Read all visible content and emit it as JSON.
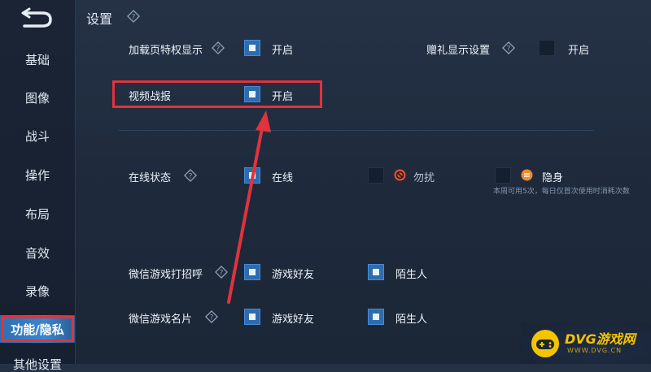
{
  "header": {
    "title": "设置"
  },
  "sidebar": {
    "items": [
      {
        "label": "基础"
      },
      {
        "label": "图像"
      },
      {
        "label": "战斗"
      },
      {
        "label": "操作"
      },
      {
        "label": "布局"
      },
      {
        "label": "音效"
      },
      {
        "label": "录像"
      },
      {
        "label": "功能/隐私",
        "active": true
      },
      {
        "label": "其他设置"
      }
    ]
  },
  "settings": {
    "loading_privilege": {
      "label": "加载页特权显示",
      "option": "开启",
      "checked": true
    },
    "gift_display": {
      "label": "赠礼显示设置",
      "option": "开启",
      "checked": false
    },
    "video_report": {
      "label": "视频战报",
      "option": "开启",
      "checked": true
    },
    "online_status": {
      "label": "在线状态",
      "options": [
        {
          "label": "在线",
          "checked": true
        },
        {
          "label": "勿扰",
          "checked": false
        },
        {
          "label": "隐身",
          "checked": false
        }
      ],
      "note": "本周可用5次，每日仅首次使用时消耗次数"
    },
    "wechat_greeting": {
      "label": "微信游戏打招呼",
      "options": [
        {
          "label": "游戏好友",
          "checked": true
        },
        {
          "label": "陌生人",
          "checked": true
        }
      ]
    },
    "wechat_card": {
      "label": "微信游戏名片",
      "options": [
        {
          "label": "游戏好友",
          "checked": true
        },
        {
          "label": "陌生人",
          "checked": true
        }
      ]
    }
  },
  "watermark": {
    "text": "DVG游戏网",
    "sub": "WWW.DVG.CN"
  },
  "colors": {
    "accent": "#2d6cb0",
    "highlight": "#e0333d",
    "watermark": "#f5c400"
  }
}
